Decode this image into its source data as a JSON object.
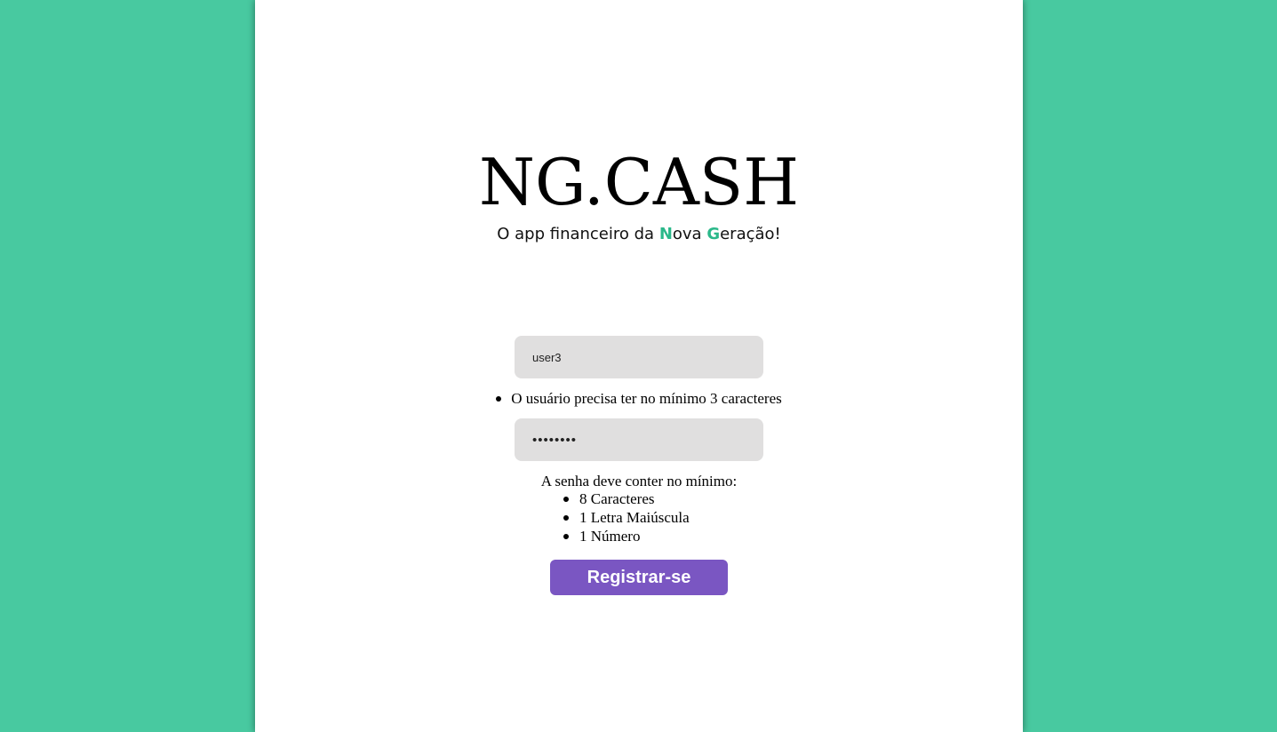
{
  "brand": {
    "logo_text": "NG.CASH",
    "tagline_prefix": "O app financeiro da ",
    "tagline_n": "N",
    "tagline_ova": "ova ",
    "tagline_g": "G",
    "tagline_suffix": "eração!",
    "highlight_color": "#2bb88a"
  },
  "form": {
    "username_value": "user3",
    "password_value": "••••••••",
    "username_rule": "O usuário precisa ter no mínimo 3 caracteres",
    "password_title": "A senha deve conter no mínimo:",
    "password_rules": [
      "8 Caracteres",
      "1 Letra Maiúscula",
      "1 Número"
    ],
    "submit_label": "Registrar-se"
  },
  "colors": {
    "background": "#48c9a0",
    "panel": "#ffffff",
    "input_bg": "#e0dfdf",
    "button": "#7a56c2"
  }
}
